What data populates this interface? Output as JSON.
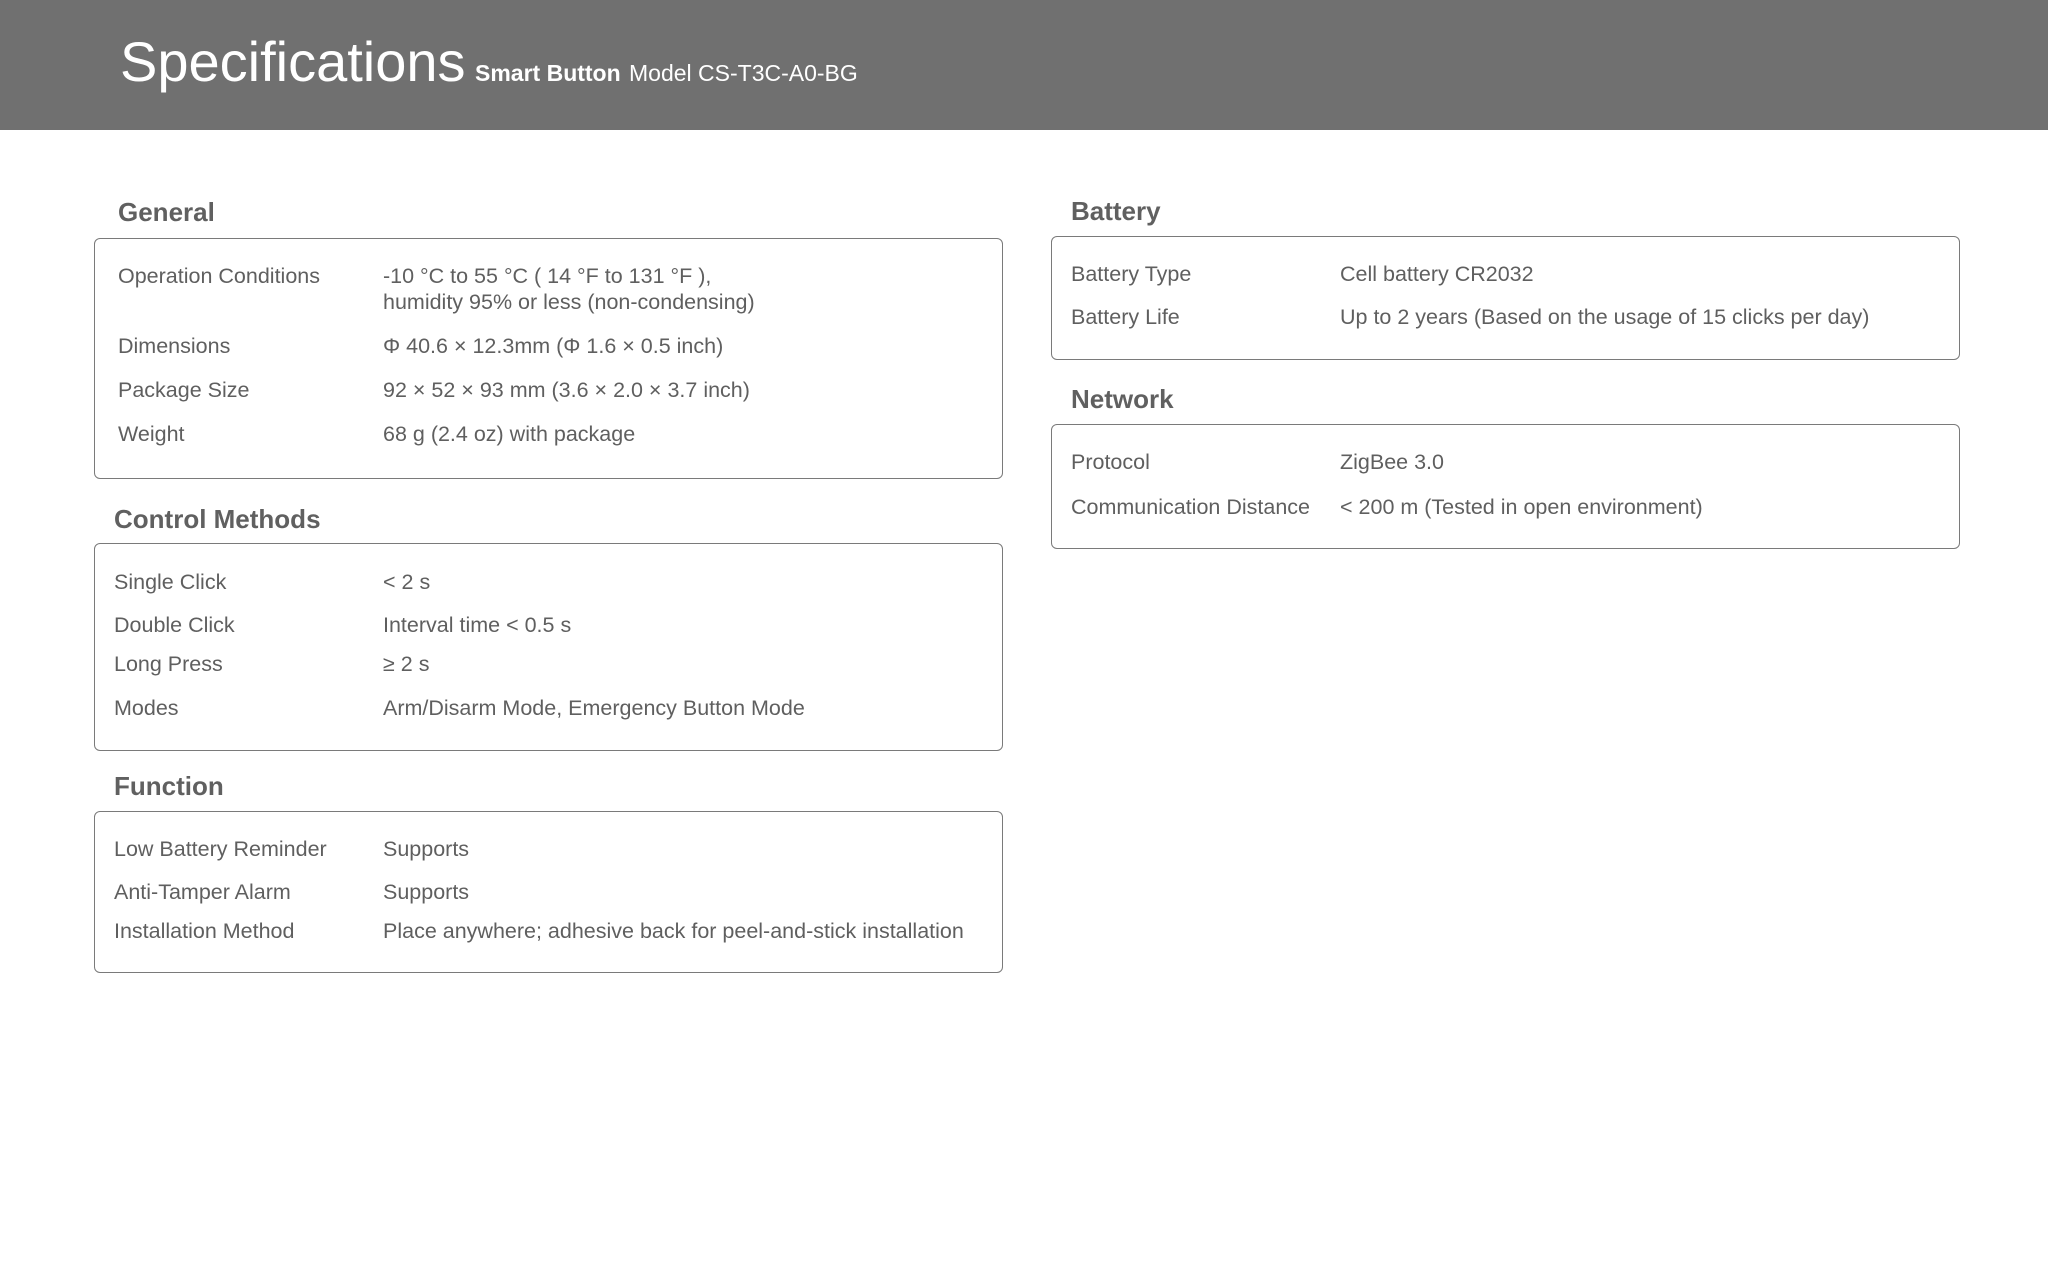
{
  "header": {
    "title": "Specifications",
    "product": "Smart Button",
    "model": "Model CS-T3C-A0-BG"
  },
  "general": {
    "title": "General",
    "rows": [
      {
        "label": "Operation Conditions",
        "value": "-10 °C to 55 °C ( 14 °F to 131 °F ),",
        "value2": "humidity 95% or less (non-condensing)"
      },
      {
        "label": "Dimensions",
        "value": "Φ 40.6 × 12.3mm (Φ 1.6 × 0.5 inch)"
      },
      {
        "label": "Package Size",
        "value": "92 × 52 × 93 mm (3.6 × 2.0 × 3.7 inch)"
      },
      {
        "label": "Weight",
        "value": "68 g (2.4 oz) with package"
      }
    ]
  },
  "control": {
    "title": "Control Methods",
    "rows": [
      {
        "label": "Single Click",
        "value": "< 2 s"
      },
      {
        "label": "Double Click",
        "value": "Interval time < 0.5 s"
      },
      {
        "label": "Long Press",
        "value": "≥ 2 s"
      },
      {
        "label": "Modes",
        "value": "Arm/Disarm Mode, Emergency Button Mode"
      }
    ]
  },
  "function": {
    "title": "Function",
    "rows": [
      {
        "label": "Low Battery Reminder",
        "value": "Supports"
      },
      {
        "label": "Anti-Tamper Alarm",
        "value": "Supports"
      },
      {
        "label": "Installation Method",
        "value": "Place anywhere; adhesive back for peel-and-stick installation"
      }
    ]
  },
  "battery": {
    "title": "Battery",
    "rows": [
      {
        "label": "Battery Type",
        "value": "Cell battery CR2032"
      },
      {
        "label": "Battery Life",
        "value": "Up to 2 years (Based on the usage of 15 clicks per day)"
      }
    ]
  },
  "network": {
    "title": "Network",
    "rows": [
      {
        "label": "Protocol",
        "value": "ZigBee 3.0"
      },
      {
        "label": "Communication Distance",
        "value": "< 200 m (Tested in open environment)"
      }
    ]
  }
}
